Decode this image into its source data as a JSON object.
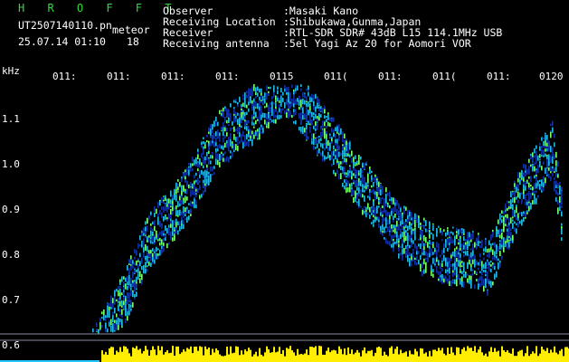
{
  "header": {
    "program": "H R O F F T",
    "filename": "UT2507140110.pn",
    "meteor_label": "meteor",
    "datetime": "25.07.14 01:10",
    "count": "18"
  },
  "info": {
    "labels": [
      "Observer",
      "Receiving Location",
      "Receiver",
      "Receiving antenna"
    ],
    "values": [
      ":Masaki Kano",
      ":Shibukawa,Gunma,Japan",
      ":RTL-SDR SDR# 43dB L15 114.1MHz USB",
      ":5el Yagi Az 20 for Aomori VOR"
    ]
  },
  "axis": {
    "unit": "kHz",
    "y_labels": [
      "1.1",
      "1.0",
      "0.9",
      "0.8",
      "0.7",
      "0.6"
    ],
    "x_labels": [
      "011:",
      "011:",
      "011:",
      "011:",
      "0115",
      "011(",
      "011:",
      "011(",
      "011:",
      "0120"
    ]
  },
  "colors": {
    "title_green": "#2edc3a",
    "text": "#ffffff",
    "noise_floor": "#ffee00",
    "baseline": "#22c8ff",
    "signal_high": "#7dff6a",
    "signal_mid": "#25b8e0",
    "signal_low": "#1430a0",
    "horizontal_lines": "#8a8aa0"
  }
}
